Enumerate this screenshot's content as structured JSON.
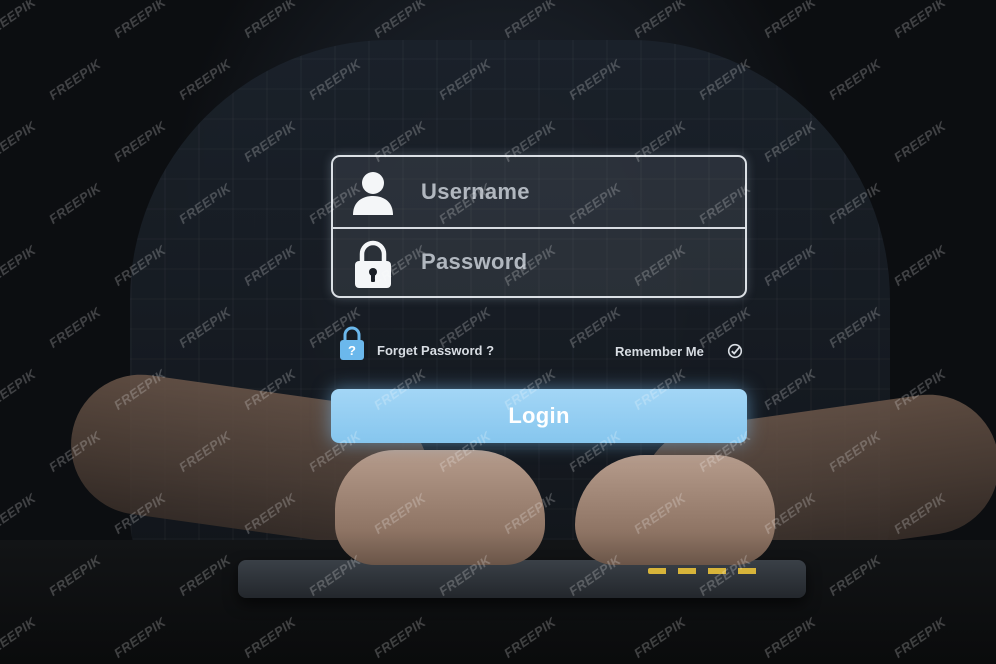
{
  "login_form": {
    "username_placeholder": "Username",
    "password_placeholder": "Password",
    "forgot_password_label": "Forget Password ?",
    "remember_me_label": "Remember Me",
    "login_button_label": "Login"
  },
  "icons": {
    "username": "user-icon",
    "password": "padlock-icon",
    "forgot_password": "padlock-question-icon",
    "remember_me": "check-circle-icon"
  },
  "colors": {
    "login_button": "#8ccaf0",
    "forgot_icon": "#6bb8ec",
    "field_border": "#ebf0f5"
  },
  "watermark": {
    "text": "FREEPIK"
  }
}
